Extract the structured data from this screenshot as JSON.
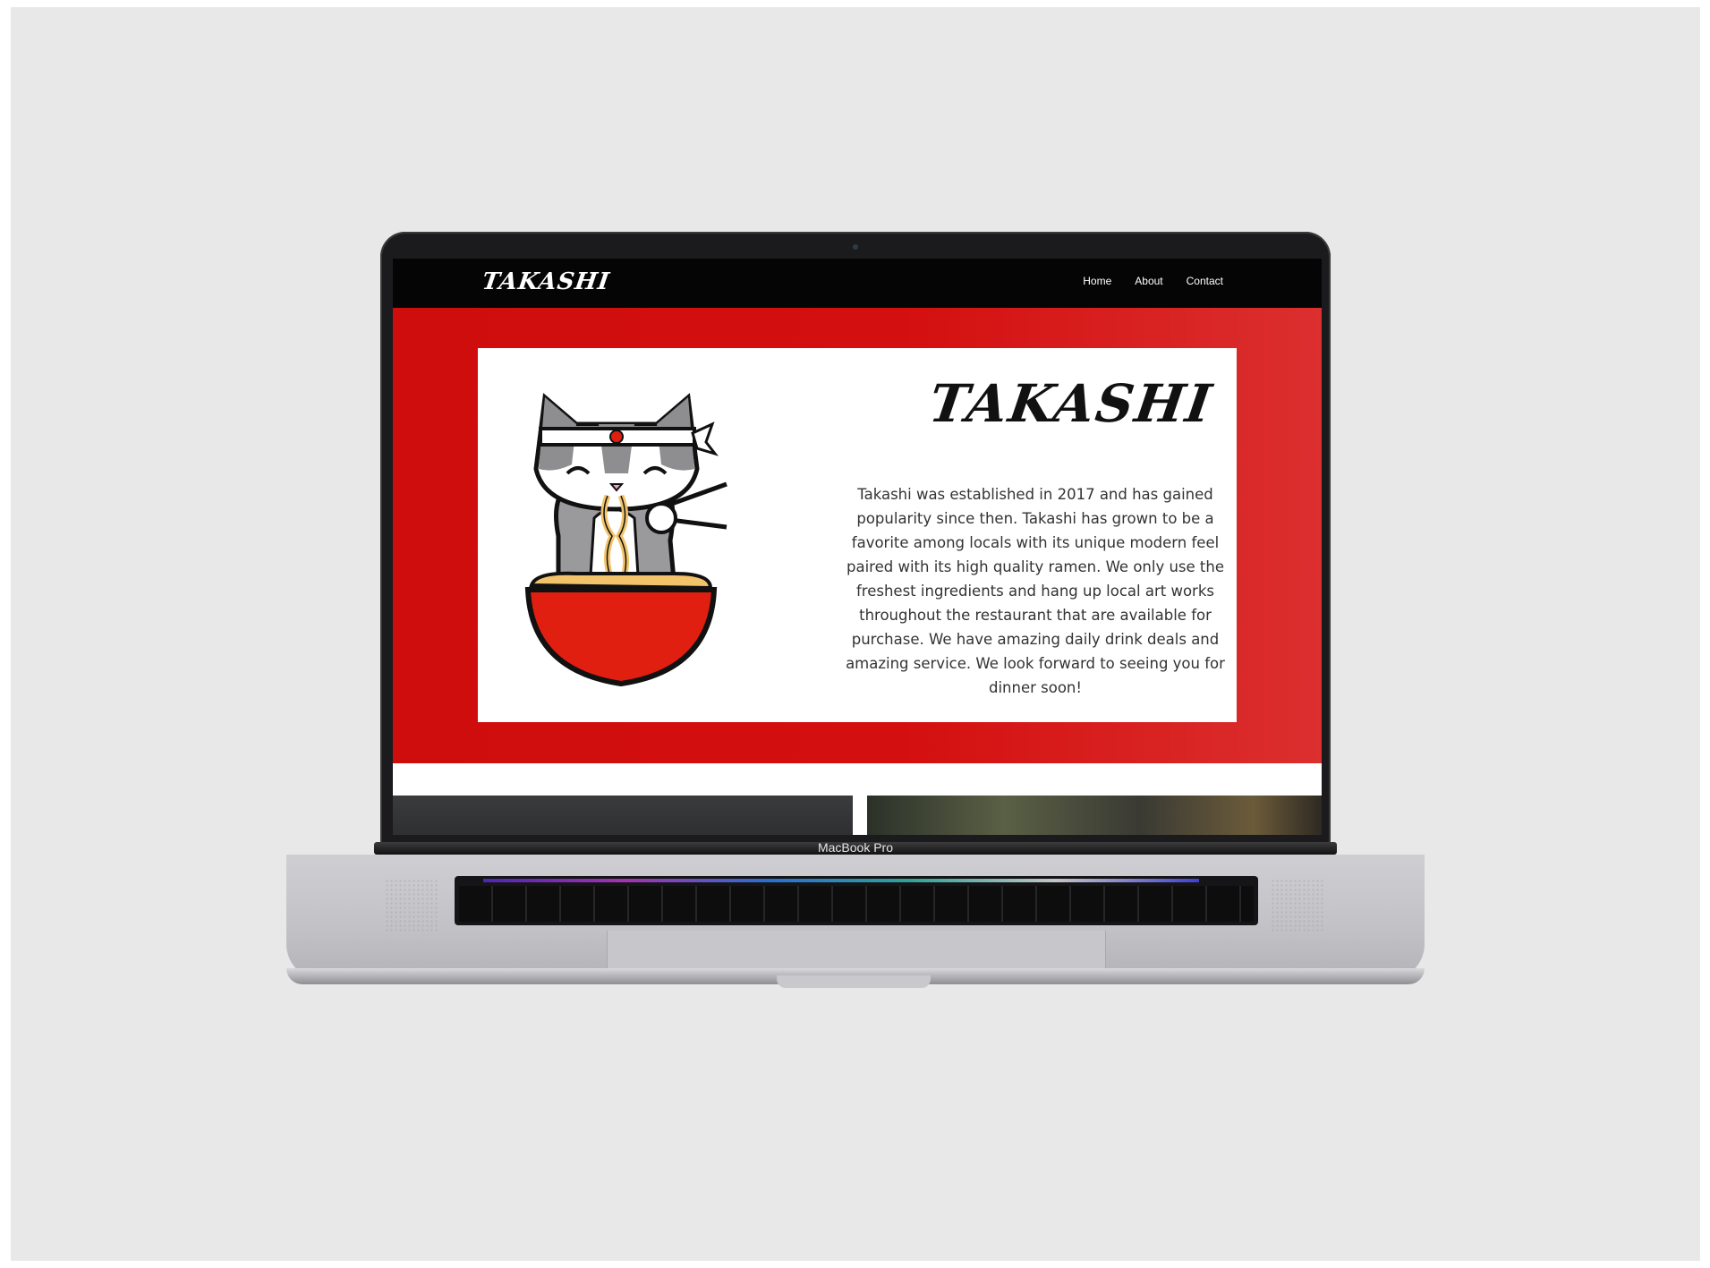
{
  "device": {
    "model_label": "MacBook Pro"
  },
  "site": {
    "logo": "TAKASHI",
    "nav": [
      "Home",
      "About",
      "Contact"
    ],
    "hero": {
      "title": "TAKASHI",
      "description": "Takashi was established in 2017 and has gained popularity since then. Takashi has grown to be a favorite among locals with its unique modern feel paired with its high quality ramen. We only use the freshest ingredients and hang up local art works throughout the restaurant that are available for purchase. We have amazing daily drink deals and amazing service. We look forward to seeing you for dinner soon!",
      "mascot_icon": "cat-eating-ramen-icon"
    }
  },
  "colors": {
    "hero_red": "#cf0d0d",
    "nav_black": "#050505",
    "bowl_red": "#e01f10"
  }
}
